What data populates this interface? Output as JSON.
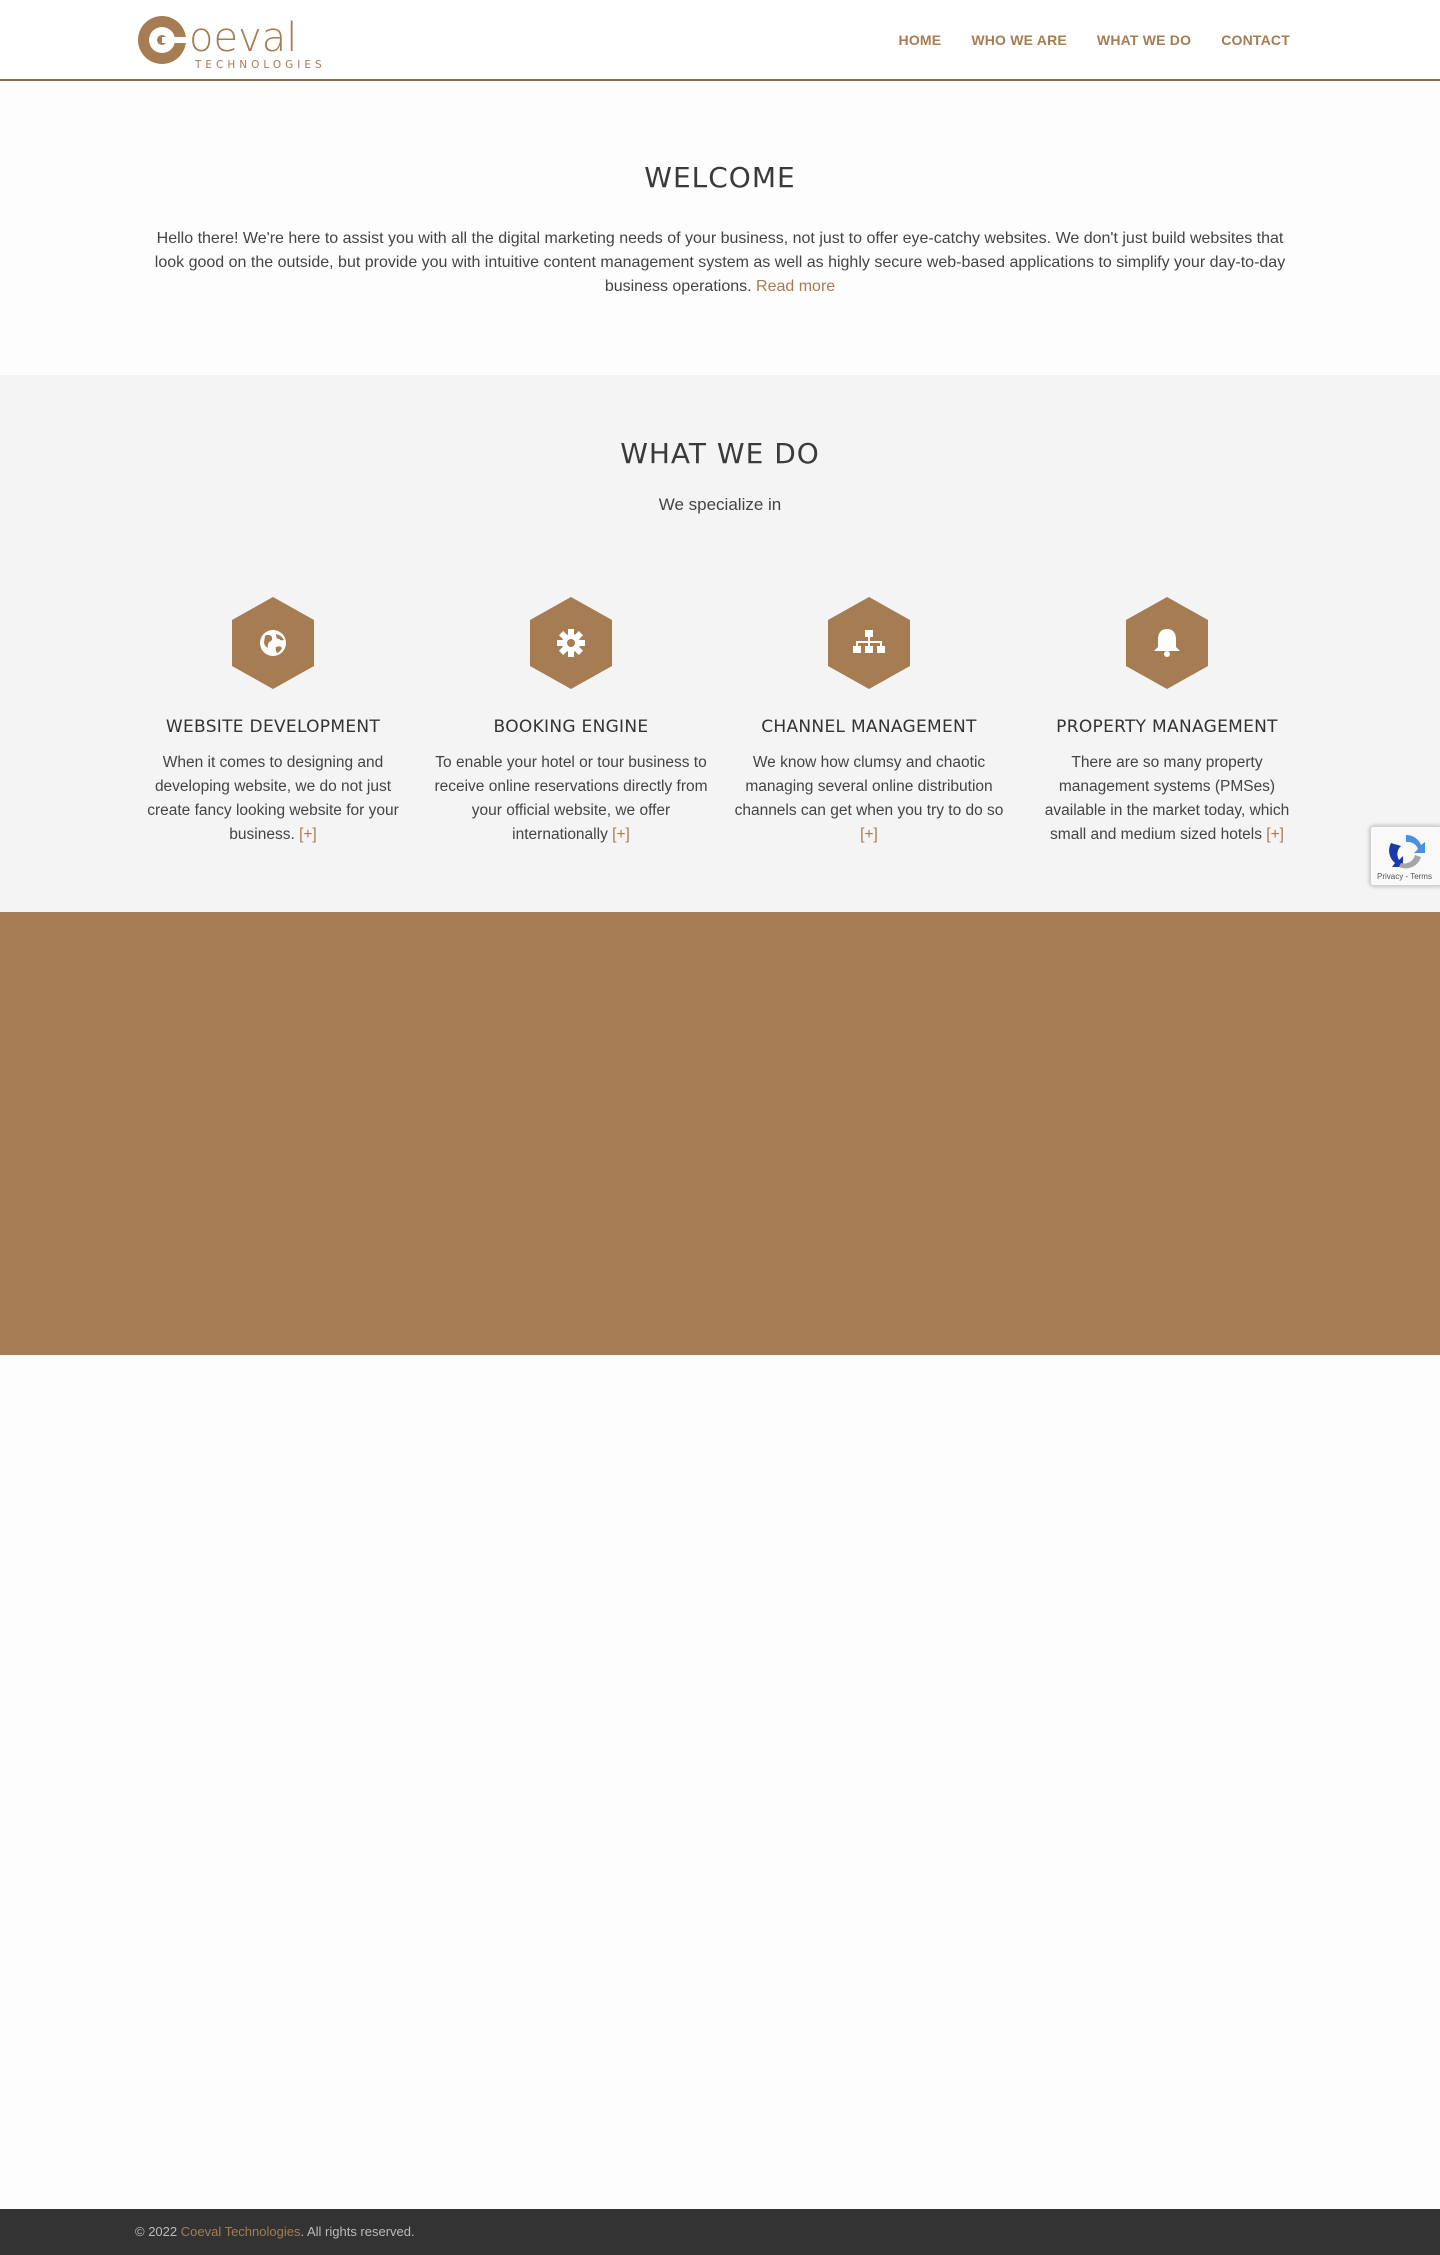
{
  "header": {
    "logo_main": "oeval",
    "logo_sub": "TECHNOLOGIES",
    "nav": [
      "HOME",
      "WHO WE ARE",
      "WHAT WE DO",
      "CONTACT"
    ]
  },
  "welcome": {
    "title": "WELCOME",
    "body": "Hello there! We're here to assist you with all the digital marketing needs of your business, not just to offer eye-catchy websites. We don't just build websites that look good on the outside, but provide you with intuitive content management system as well as highly secure web-based applications to simplify your day-to-day business operations.",
    "read_more": "Read more"
  },
  "whatwedo": {
    "title": "WHAT WE DO",
    "subtitle": "We specialize in",
    "services": [
      {
        "icon": "globe-icon",
        "title": "WEBSITE DEVELOPMENT",
        "text": "When it comes to designing and developing website, we do not just create fancy looking website for your business.",
        "more": "[+]"
      },
      {
        "icon": "gear-icon",
        "title": "BOOKING ENGINE",
        "text": "To enable your hotel or tour business to receive online reservations directly from your official website, we offer internationally",
        "more": "[+]"
      },
      {
        "icon": "sitemap-icon",
        "title": "CHANNEL MANAGEMENT",
        "text": "We know how clumsy and chaotic managing several online distribution channels can get when you try to do so",
        "more": "[+]"
      },
      {
        "icon": "bell-icon",
        "title": "PROPERTY MANAGEMENT",
        "text": "There are so many property management systems (PMSes) available in the market today, which small and medium sized hotels",
        "more": "[+]"
      }
    ]
  },
  "recaptcha": {
    "label": "Privacy - Terms"
  },
  "footer": {
    "prefix": "© 2022 ",
    "company": "Coeval Technologies",
    "suffix": ". All rights reserved."
  },
  "colors": {
    "accent": "#a67c52",
    "section_bg": "#f4f4f4",
    "footer_bg": "#333333"
  }
}
